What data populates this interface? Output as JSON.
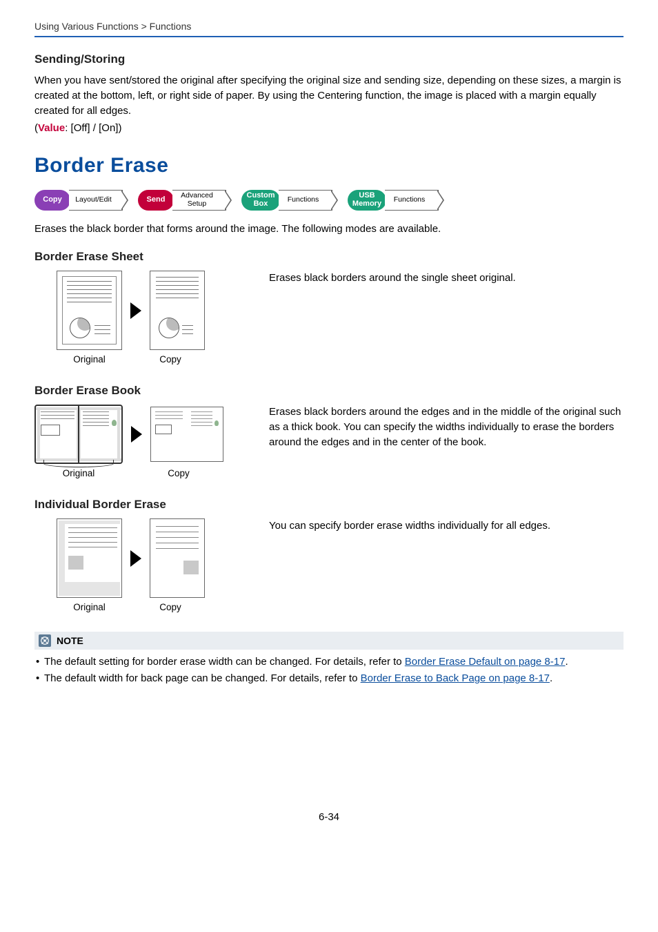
{
  "breadcrumb": "Using Various Functions > Functions",
  "sending_storing": {
    "heading": "Sending/Storing",
    "body": "When you have sent/stored the original after specifying the original size and sending size, depending on these sizes, a margin is created at the bottom, left, or right side of paper. By using the Centering function, the image is placed with a margin equally created for all edges.",
    "value_label": "Value",
    "value_options": ": [Off] / [On])"
  },
  "border_erase": {
    "title": "Border Erase",
    "pills": {
      "copy": "Copy",
      "copy_tab": "Layout/Edit",
      "send": "Send",
      "send_tab_l1": "Advanced",
      "send_tab_l2": "Setup",
      "custom_l1": "Custom",
      "custom_l2": "Box",
      "custom_tab": "Functions",
      "usb_l1": "USB",
      "usb_l2": "Memory",
      "usb_tab": "Functions"
    },
    "intro": "Erases the black border that forms around the image. The following modes are available.",
    "modes": {
      "sheet": {
        "heading": "Border Erase Sheet",
        "desc": "Erases black borders around the single sheet original.",
        "cap_original": "Original",
        "cap_copy": "Copy"
      },
      "book": {
        "heading": "Border Erase Book",
        "desc": "Erases black borders around the edges and in the middle of the original such as a thick book. You can specify the widths individually to erase the borders around the edges and in the center of the book.",
        "cap_original": "Original",
        "cap_copy": "Copy"
      },
      "individual": {
        "heading": "Individual Border Erase",
        "desc": "You can specify border erase widths individually for all edges.",
        "cap_original": "Original",
        "cap_copy": "Copy"
      }
    }
  },
  "note": {
    "label": "NOTE",
    "bullet1_a": "The default setting for border erase width can be changed. For details, refer to ",
    "bullet1_link": "Border Erase Default on page 8-17",
    "bullet2_a": "The default width for back page can be changed. For details, refer to ",
    "bullet2_link": "Border Erase to Back Page on page 8-17"
  },
  "page_number": "6-34"
}
